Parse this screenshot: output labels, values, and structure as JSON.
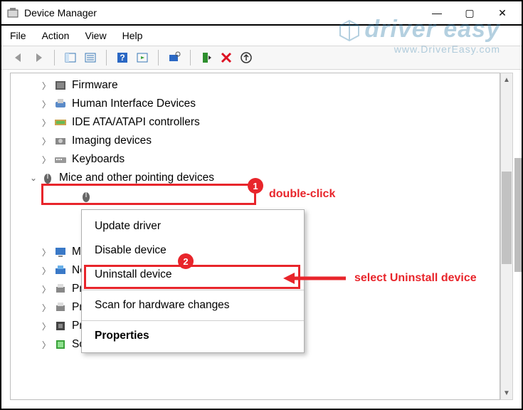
{
  "window": {
    "title": "Device Manager",
    "controls": {
      "min": "—",
      "max": "▢",
      "close": "✕"
    }
  },
  "menu": [
    "File",
    "Action",
    "View",
    "Help"
  ],
  "tree": {
    "items": [
      {
        "label": "Firmware",
        "collapsed": true
      },
      {
        "label": "Human Interface Devices",
        "collapsed": true
      },
      {
        "label": "IDE ATA/ATAPI controllers",
        "collapsed": true
      },
      {
        "label": "Imaging devices",
        "collapsed": true
      },
      {
        "label": "Keyboards",
        "collapsed": true
      },
      {
        "label": "Mice and other pointing devices",
        "collapsed": false,
        "highlighted": true
      },
      {
        "label": "Mo",
        "collapsed": true,
        "truncated": true
      },
      {
        "label": "Net",
        "collapsed": true,
        "truncated": true
      },
      {
        "label": "Prin",
        "collapsed": true,
        "truncated": true
      },
      {
        "label": "Prin",
        "collapsed": true,
        "truncated": true
      },
      {
        "label": "Pro",
        "collapsed": true,
        "truncated": true
      },
      {
        "label": "Software components",
        "collapsed": true
      }
    ]
  },
  "context_menu": {
    "items": [
      "Update driver",
      "Disable device",
      "Uninstall device",
      "Scan for hardware changes",
      "Properties"
    ],
    "highlighted_index": 2
  },
  "annotations": {
    "badge1": "1",
    "badge2": "2",
    "text1": "double-click",
    "text2_prefix": "select ",
    "text2_bold": "Uninstall device"
  },
  "watermark": {
    "brand": "driver easy",
    "url": "www.DriverEasy.com"
  }
}
